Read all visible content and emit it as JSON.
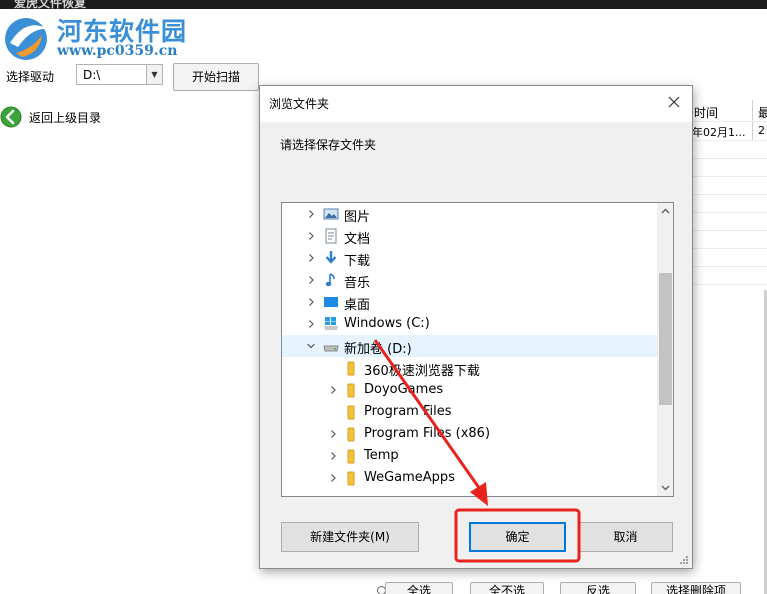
{
  "app": {
    "title": "爱虎文件恢复",
    "logo_text": "河东软件园",
    "logo_url": "www.pc0359.cn"
  },
  "toolbar": {
    "drive_label": "选择驱动",
    "drive_value": "D:\\",
    "scan_label": "开始扫描"
  },
  "left_panel": {
    "back_label": "返回上级目录"
  },
  "file_list": {
    "headers": [
      "时间",
      "最"
    ],
    "row1": [
      "年02月1...",
      "2"
    ]
  },
  "bottom_buttons": [
    "全选",
    "全不选",
    "反选",
    "选择删除项"
  ],
  "dialog": {
    "title": "浏览文件夹",
    "subtitle": "请选择保存文件夹",
    "tree": [
      {
        "label": "图片",
        "icon": "pictures-folder-icon",
        "expandable": true
      },
      {
        "label": "文档",
        "icon": "documents-folder-icon",
        "expandable": true
      },
      {
        "label": "下载",
        "icon": "downloads-folder-icon",
        "expandable": true
      },
      {
        "label": "音乐",
        "icon": "music-folder-icon",
        "expandable": true
      },
      {
        "label": "桌面",
        "icon": "desktop-folder-icon",
        "expandable": true
      },
      {
        "label": "Windows (C:)",
        "icon": "windows-drive-icon",
        "expandable": true
      },
      {
        "label": "新加卷 (D:)",
        "icon": "drive-icon",
        "expanded": true,
        "selected": true
      },
      {
        "label": "360极速浏览器下载",
        "icon": "folder-icon",
        "expandable": false
      },
      {
        "label": "DoyoGames",
        "icon": "folder-icon",
        "expandable": true
      },
      {
        "label": "Program Files",
        "icon": "folder-icon",
        "expandable": false
      },
      {
        "label": "Program Files (x86)",
        "icon": "folder-icon",
        "expandable": true
      },
      {
        "label": "Temp",
        "icon": "folder-icon",
        "expandable": true
      },
      {
        "label": "WeGameApps",
        "icon": "folder-icon",
        "expandable": true
      }
    ],
    "new_folder_label": "新建文件夹(M)",
    "ok_label": "确定",
    "cancel_label": "取消"
  },
  "colors": {
    "annotation_red": "#e8231e",
    "selection": "#e5f3ff",
    "logo_blue": "#3a8fd6",
    "folder_yellow": "#f2c23a"
  }
}
